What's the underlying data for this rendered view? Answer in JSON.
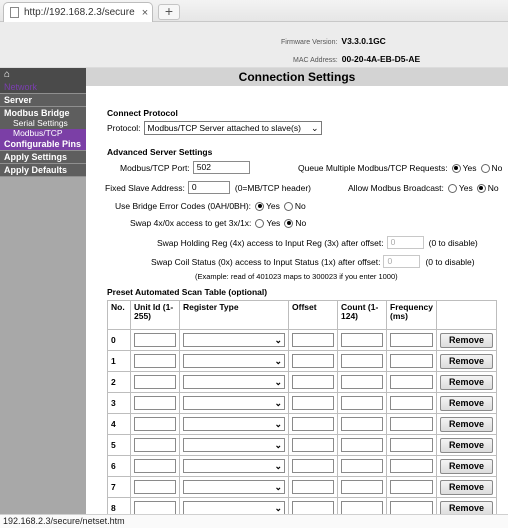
{
  "browser": {
    "tab_title": "http://192.168.2.3/secure",
    "tab_close": "×",
    "new_tab": "+",
    "status_url": "192.168.2.3/secure/netset.htm"
  },
  "header": {
    "firmware_label": "Firmware Version:",
    "firmware_value": "V3.3.0.1GC",
    "mac_label": "MAC Address:",
    "mac_value": "00-20-4A-EB-D5-AE"
  },
  "sidebar": {
    "home_icon": "⌂",
    "network": "Network",
    "server": "Server",
    "modbus_bridge": "Modbus Bridge",
    "serial_settings": "Serial Settings",
    "modbus_tcp": "Modbus/TCP",
    "configurable_pins": "Configurable Pins",
    "apply_settings": "Apply Settings",
    "apply_defaults": "Apply Defaults"
  },
  "page_title": "Connection Settings",
  "connect": {
    "heading": "Connect Protocol",
    "protocol_label": "Protocol:",
    "protocol_value": "Modbus/TCP Server attached to slave(s)"
  },
  "advanced": {
    "heading": "Advanced Server Settings",
    "port_label": "Modbus/TCP Port:",
    "port_value": "502",
    "queue_label": "Queue Multiple Modbus/TCP Requests:",
    "fixed_slave_label": "Fixed Slave Address:",
    "fixed_slave_value": "0",
    "fixed_slave_note": "(0=MB/TCP header)",
    "broadcast_label": "Allow Modbus Broadcast:",
    "bridge_errors_label": "Use Bridge Error Codes (0AH/0BH):",
    "swap_label": "Swap 4x/0x access to get 3x/1x:",
    "yes": "Yes",
    "no": "No",
    "holding_label": "Swap Holding Reg (4x) access to Input Reg (3x) after offset:",
    "holding_value": "0",
    "coil_label": "Swap Coil Status (0x) access to Input Status (1x) after offset:",
    "coil_value": "0",
    "disable_note": "(0 to disable)",
    "example_note": "(Example: read of 401023 maps to 300023 if you enter 1000)"
  },
  "scan_table": {
    "heading": "Preset Automated Scan Table (optional)",
    "headers": [
      "No.",
      "Unit Id (1-255)",
      "Register Type",
      "Offset",
      "Count (1-124)",
      "Frequency (ms)"
    ],
    "rows": [
      "0",
      "1",
      "2",
      "3",
      "4",
      "5",
      "6",
      "7",
      "8"
    ],
    "remove_label": "Remove"
  },
  "icons": {
    "home": "home-icon",
    "chevron": "chevron-down-icon",
    "page": "page-icon"
  }
}
